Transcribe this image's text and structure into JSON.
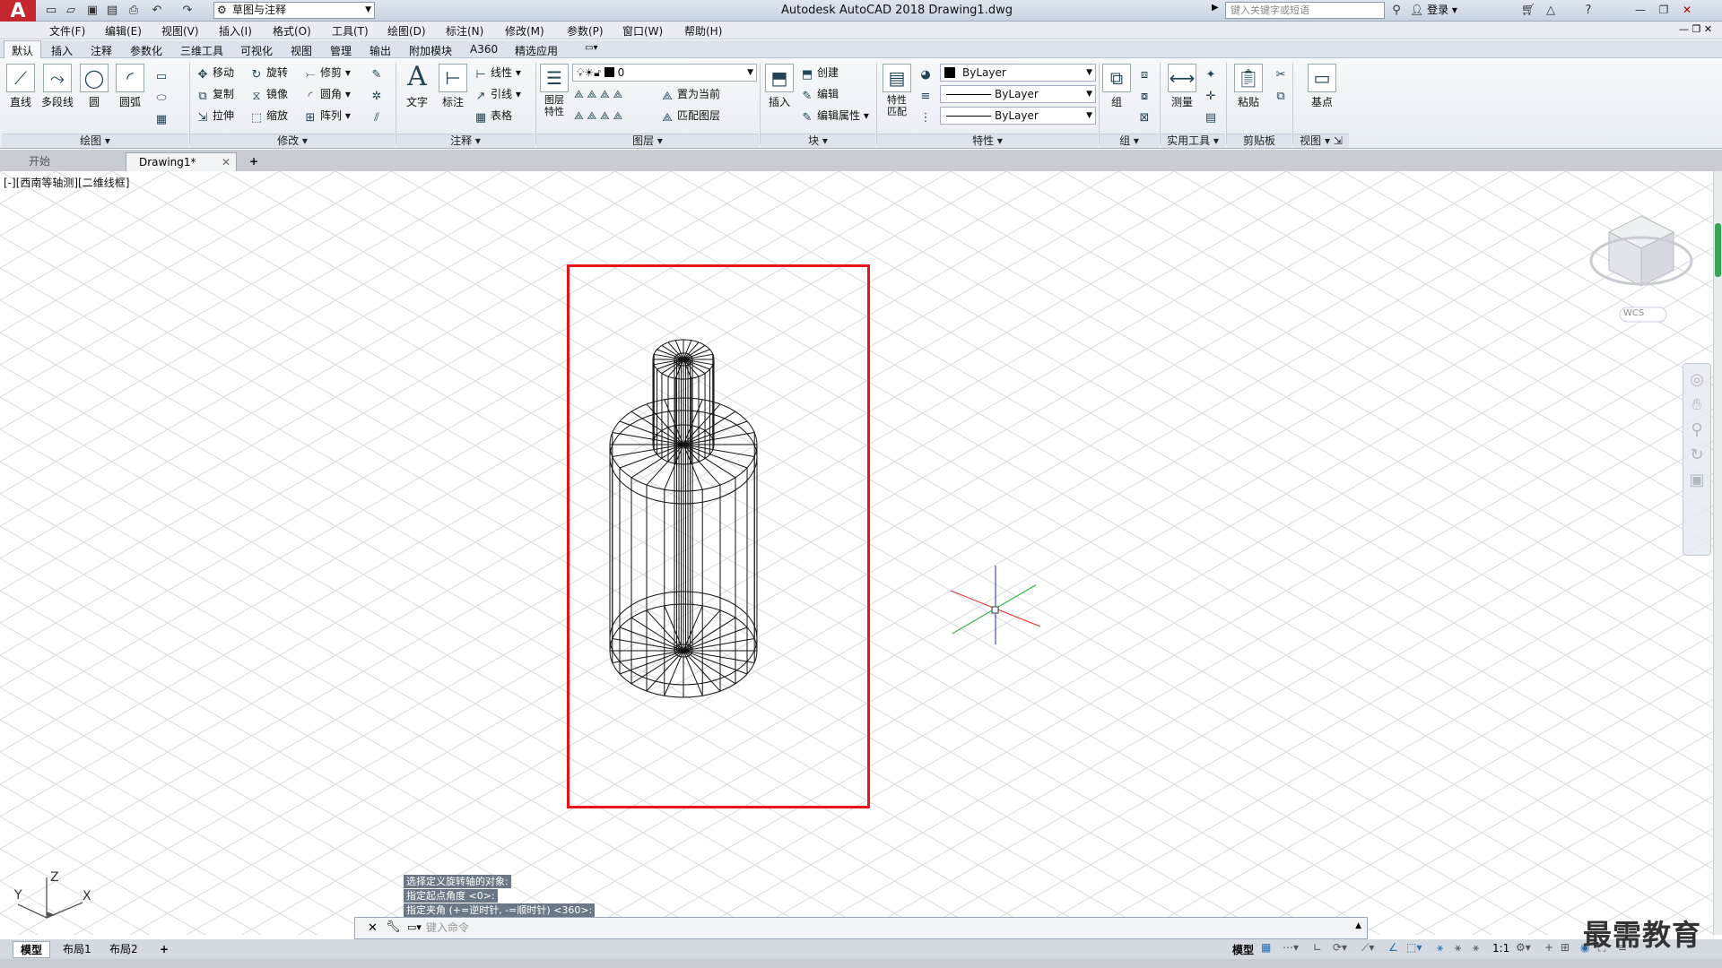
{
  "app": {
    "logo": "A",
    "title": "Autodesk AutoCAD 2018    Drawing1.dwg",
    "workspace": "草图与注释",
    "search_placeholder": "键入关键字或短语",
    "login": "登录"
  },
  "menubar": [
    "文件(F)",
    "编辑(E)",
    "视图(V)",
    "插入(I)",
    "格式(O)",
    "工具(T)",
    "绘图(D)",
    "标注(N)",
    "修改(M)",
    "参数(P)",
    "窗口(W)",
    "帮助(H)"
  ],
  "ribbon_tabs": [
    "默认",
    "插入",
    "注释",
    "参数化",
    "三维工具",
    "可视化",
    "视图",
    "管理",
    "输出",
    "附加模块",
    "A360",
    "精选应用"
  ],
  "ribbon": {
    "draw": {
      "title": "绘图",
      "line": "直线",
      "polyline": "多段线",
      "circle": "圆",
      "arc": "圆弧"
    },
    "modify": {
      "title": "修改",
      "move": "移动",
      "rotate": "旋转",
      "trim": "修剪",
      "copy": "复制",
      "mirror": "镜像",
      "fillet": "圆角",
      "stretch": "拉伸",
      "scale": "缩放",
      "array": "阵列"
    },
    "annotation": {
      "title": "注释",
      "text": "文字",
      "dimension": "标注",
      "linear": "线性",
      "leader": "引线",
      "table": "表格"
    },
    "layers": {
      "title": "图层",
      "properties": "图层特性",
      "current_layer": "0",
      "set_current": "置为当前",
      "match": "匹配图层"
    },
    "block": {
      "title": "块",
      "insert": "插入",
      "create": "创建",
      "edit": "编辑",
      "edit_attr": "编辑属性"
    },
    "properties": {
      "title": "特性",
      "match": "特性匹配",
      "color": "ByLayer",
      "linetype": "ByLayer",
      "lineweight": "ByLayer"
    },
    "group": {
      "title": "组",
      "group": "组"
    },
    "utilities": {
      "title": "实用工具",
      "measure": "测量"
    },
    "clipboard": {
      "title": "剪贴板",
      "paste": "粘贴"
    },
    "view": {
      "title": "视图",
      "base": "基点"
    }
  },
  "file_tabs": {
    "start": "开始",
    "drawing": "Drawing1*",
    "add": "+"
  },
  "viewport": {
    "label": "[-][西南等轴测][二维线框]",
    "viewcube_wcs": "WCS",
    "ucs_z": "Z",
    "ucs_x": "X",
    "ucs_y": "Y"
  },
  "command": {
    "history": [
      "选择定义旋转轴的对象:",
      "指定起点角度 <0>:",
      "指定夹角 (+=逆时针, -=顺时针) <360>:"
    ],
    "placeholder": "键入命令"
  },
  "layout_tabs": [
    "模型",
    "布局1",
    "布局2",
    "+"
  ],
  "status": {
    "model": "模型",
    "scale": "1:1"
  },
  "watermark": "最需教育",
  "colors": {
    "highlight_box": "#e8141a",
    "logo_red": "#c6262e",
    "grid": "#d7dbe0"
  }
}
